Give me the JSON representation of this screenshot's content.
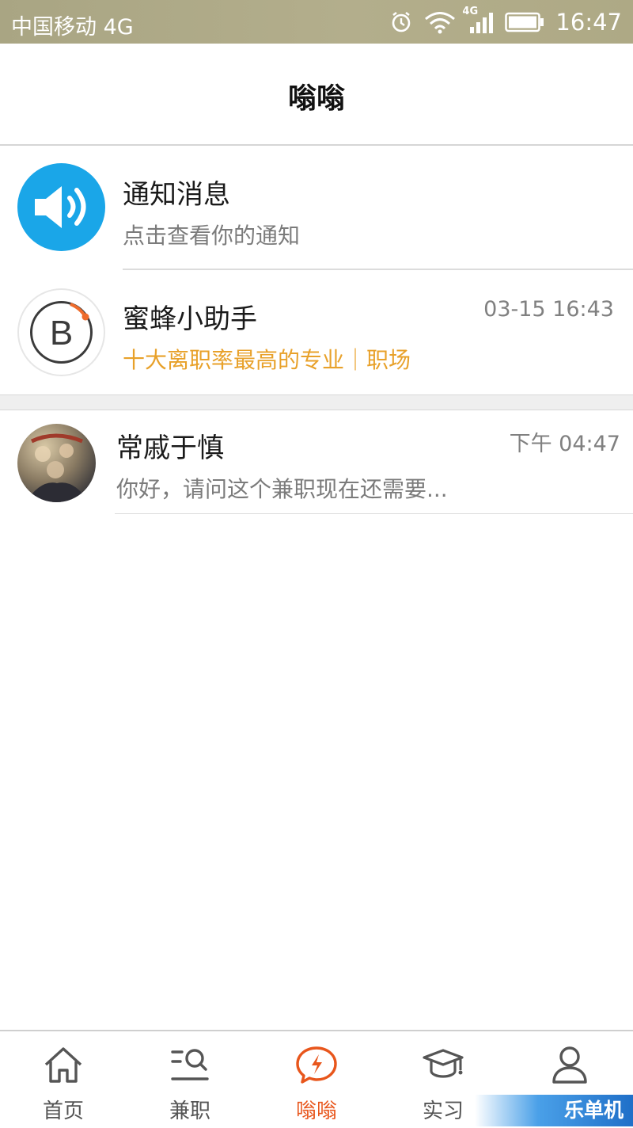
{
  "status_bar": {
    "carrier": "中国移动 4G",
    "network_badge": "4G",
    "time": "16:47"
  },
  "header": {
    "title": "嗡嗡"
  },
  "notice": {
    "name": "通知消息",
    "subtitle": "点击查看你的通知",
    "icon": "speaker-icon",
    "icon_color": "#1aa6e8"
  },
  "helper": {
    "name": "蜜蜂小助手",
    "time": "03-15 16:43",
    "message": "十大离职率最高的专业｜职场",
    "message_color": "#e8a12a",
    "avatar_letter": "B"
  },
  "chat": {
    "name": "常戚于慎",
    "time": "下午 04:47",
    "preview": "你好，请问这个兼职现在还需要..."
  },
  "bottom_nav": {
    "items": [
      {
        "label": "首页",
        "icon": "home-icon"
      },
      {
        "label": "兼职",
        "icon": "job-search-icon"
      },
      {
        "label": "嗡嗡",
        "icon": "message-bolt-icon",
        "active": true
      },
      {
        "label": "实习",
        "icon": "graduation-cap-icon"
      },
      {
        "label": "",
        "icon": "profile-icon"
      }
    ],
    "active_color": "#e8561c"
  },
  "watermark": {
    "text": "乐单机"
  }
}
